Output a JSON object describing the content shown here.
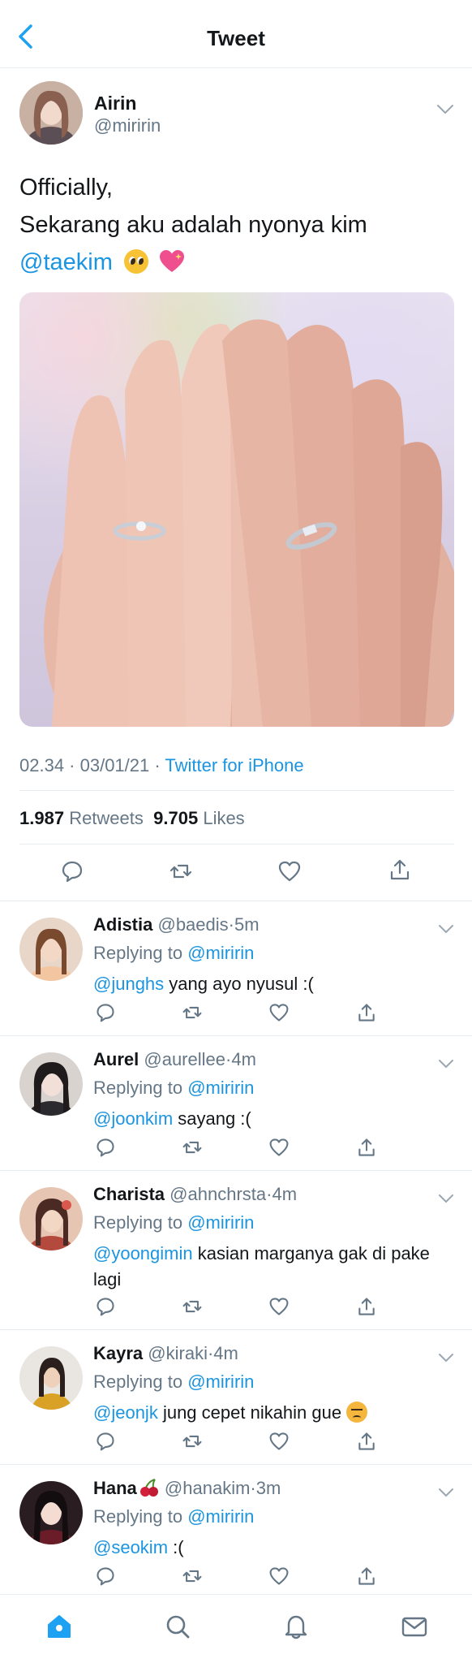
{
  "header": {
    "title": "Tweet"
  },
  "main_tweet": {
    "name": "Airin",
    "handle": "@miririn",
    "text_line1": "Officially,",
    "text_line2": "Sekarang aku adalah nyonya kim",
    "mention": "@taekim",
    "timestamp": "02.34 · 03/01/21 · ",
    "source": "Twitter for iPhone",
    "retweets_count": "1.987",
    "retweets_label": "Retweets",
    "likes_count": "9.705",
    "likes_label": "Likes"
  },
  "replies": [
    {
      "name": "Adistia",
      "handle": "@baedis",
      "time": "5m",
      "replying_prefix": "Replying to ",
      "replying_to": "@miririn",
      "mention": "@junghs",
      "text": " yang ayo nyusul :("
    },
    {
      "name": "Aurel",
      "handle": "@aurellee",
      "time": "4m",
      "replying_prefix": "Replying to ",
      "replying_to": "@miririn",
      "mention": "@joonkim",
      "text": " sayang :("
    },
    {
      "name": "Charista",
      "handle": "@ahnchrsta",
      "time": "4m",
      "replying_prefix": "Replying to ",
      "replying_to": "@miririn",
      "mention": "@yoongimin",
      "text": " kasian marganya gak di pake lagi"
    },
    {
      "name": "Kayra",
      "handle": "@kiraki",
      "time": "4m",
      "replying_prefix": "Replying to ",
      "replying_to": "@miririn",
      "mention": "@jeonjk",
      "text": " jung cepet nikahin gue "
    },
    {
      "name": "Hana",
      "handle": "@hanakim",
      "time": "3m",
      "replying_prefix": "Replying to ",
      "replying_to": "@miririn",
      "mention": "@seokim",
      "text": " :("
    }
  ],
  "colors": {
    "accent": "#1b95e0",
    "muted": "#657786",
    "text": "#14171a",
    "divider": "#e6ecf0"
  },
  "icons": [
    "back-arrow-icon",
    "chevron-down-icon",
    "reply-icon",
    "retweet-icon",
    "like-icon",
    "share-icon",
    "home-icon",
    "search-icon",
    "notifications-icon",
    "messages-icon"
  ]
}
